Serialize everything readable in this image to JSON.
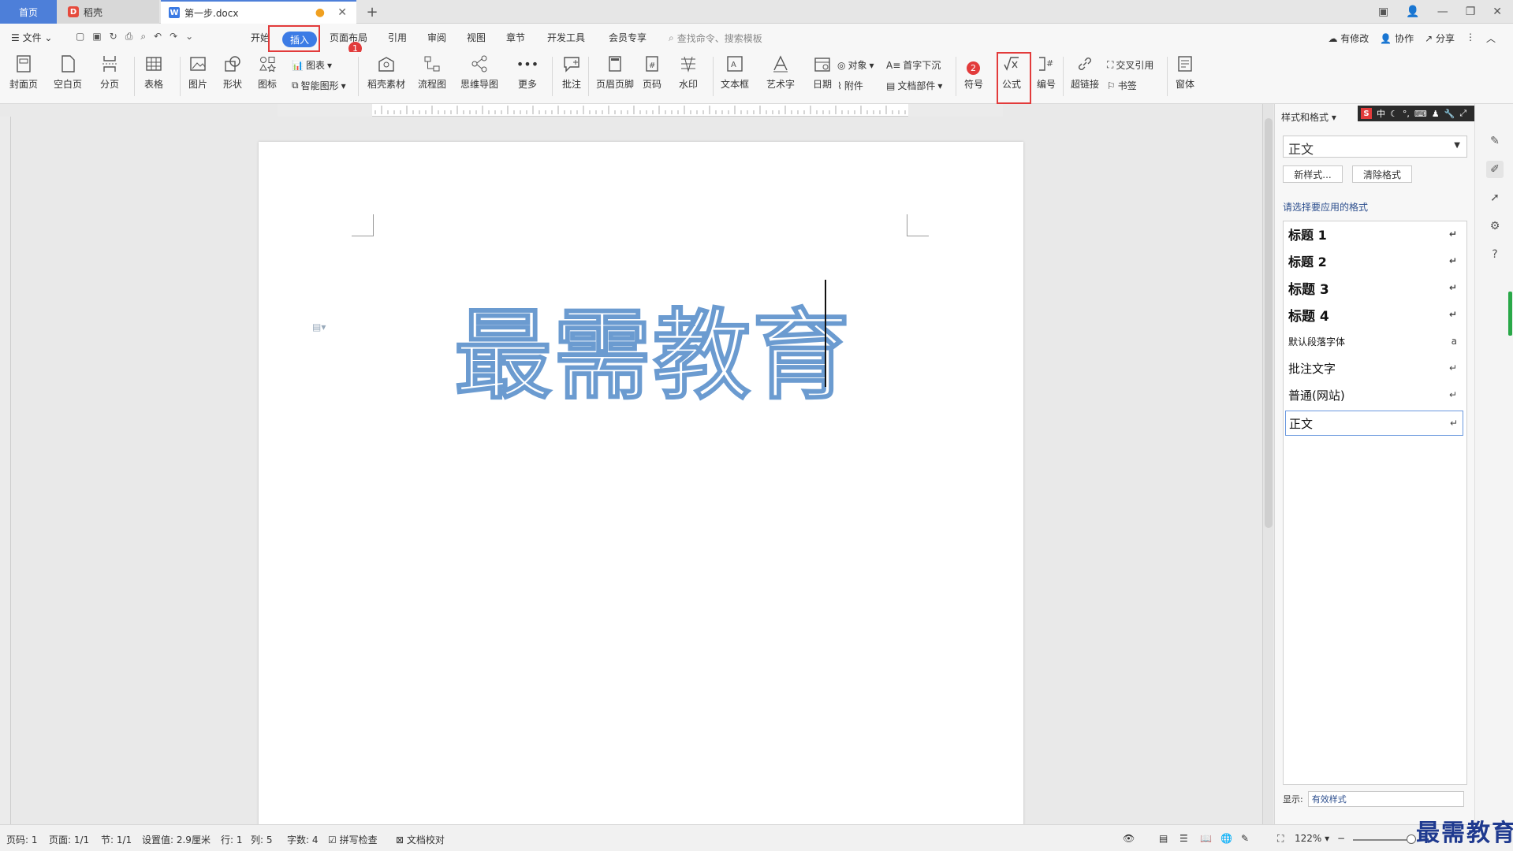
{
  "titlebar": {
    "tabs": {
      "home": "首页",
      "daoke": "稻壳",
      "doc": "第一步.docx"
    },
    "new_tab": "+"
  },
  "menu": {
    "file": "文件",
    "start": "开始",
    "insert": "插入",
    "layout": "页面布局",
    "reference": "引用",
    "review": "审阅",
    "view": "视图",
    "chapter": "章节",
    "dev": "开发工具",
    "member": "会员专享",
    "search_placeholder": "查找命令、搜索模板",
    "modify": "有修改",
    "collab": "协作",
    "share": "分享"
  },
  "badges": {
    "one": "1",
    "two": "2"
  },
  "ribbon": {
    "cover": "封面页",
    "blank": "空白页",
    "pagebreak": "分页",
    "table": "表格",
    "picture": "图片",
    "shape": "形状",
    "icon": "图标",
    "chart": "图表",
    "smartart": "智能图形",
    "material": "稻壳素材",
    "flow": "流程图",
    "mindmap": "思维导图",
    "more": "更多",
    "comment": "批注",
    "header": "页眉页脚",
    "pagenum": "页码",
    "watermark": "水印",
    "textbox": "文本框",
    "arttext": "艺术字",
    "date": "日期",
    "object": "对象",
    "attach": "附件",
    "dropcap": "首字下沉",
    "docpart": "文档部件",
    "symbol": "符号",
    "formula": "公式",
    "numbering": "编号",
    "hyperlink": "超链接",
    "crossref": "交叉引用",
    "bookmark": "书签",
    "window": "窗体"
  },
  "document": {
    "heading_text": "最需教育"
  },
  "panel": {
    "title": "样式和格式",
    "current_style": "正文",
    "new_style": "新样式...",
    "clear_format": "清除格式",
    "apply_label": "请选择要应用的格式",
    "styles": [
      "标题 1",
      "标题 2",
      "标题 3",
      "标题 4",
      "默认段落字体",
      "批注文字",
      "普通(网站)",
      "正文"
    ],
    "show_label": "显示:",
    "show_value": "有效样式"
  },
  "ime": {
    "lang": "中"
  },
  "status": {
    "page_code": "页码: 1",
    "page": "页面: 1/1",
    "section": "节: 1/1",
    "setting": "设置值: 2.9厘米",
    "row": "行: 1",
    "col": "列: 5",
    "words": "字数: 4",
    "spell": "拼写检查",
    "proof": "文档校对",
    "zoom": "122%"
  },
  "watermark_text": "最需教育",
  "colors": {
    "accent": "#3c7be5",
    "highlight_red": "#e23b3b",
    "outline_text": "#6b9bd0"
  }
}
